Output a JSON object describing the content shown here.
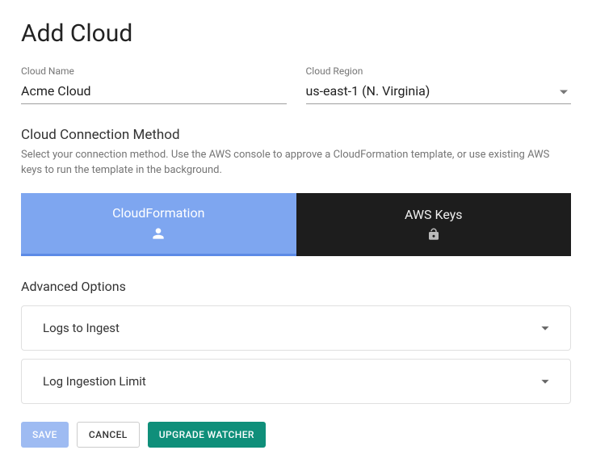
{
  "title": "Add Cloud",
  "fields": {
    "cloud_name": {
      "label": "Cloud Name",
      "value": "Acme Cloud"
    },
    "cloud_region": {
      "label": "Cloud Region",
      "value": "us-east-1 (N. Virginia)"
    }
  },
  "connection": {
    "heading": "Cloud Connection Method",
    "description": "Select your connection method. Use the AWS console to approve a CloudFormation template, or use existing AWS keys to run the template in the background.",
    "options": {
      "cloudformation": "CloudFormation",
      "aws_keys": "AWS Keys"
    },
    "selected": "cloudformation"
  },
  "advanced": {
    "heading": "Advanced Options",
    "panels": {
      "logs_to_ingest": "Logs to Ingest",
      "log_ingestion_limit": "Log Ingestion Limit"
    }
  },
  "buttons": {
    "save": "Save",
    "cancel": "Cancel",
    "upgrade_watcher": "Upgrade Watcher"
  }
}
